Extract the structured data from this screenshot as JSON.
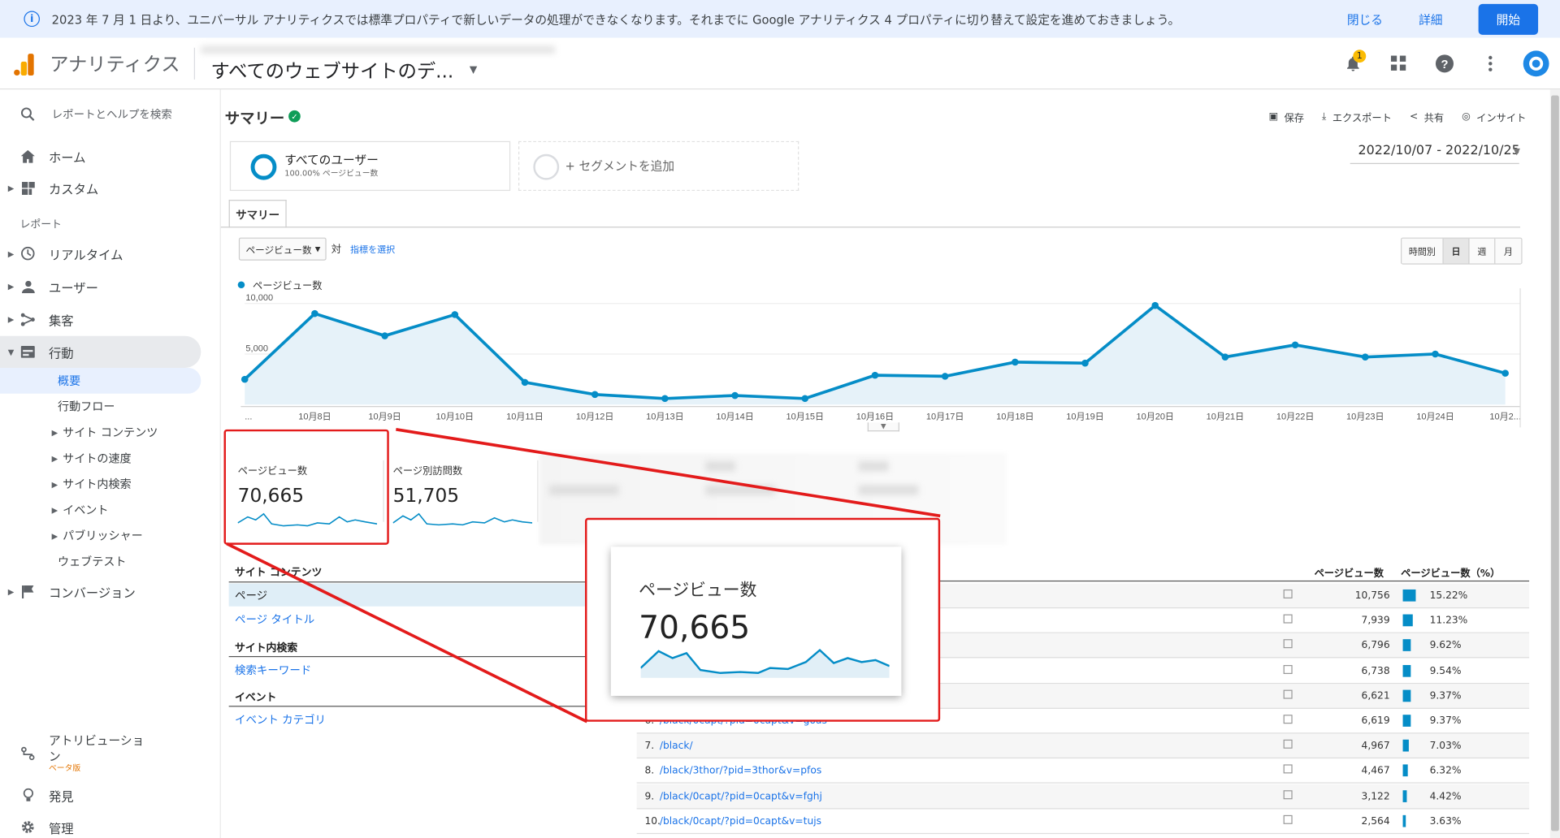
{
  "banner": {
    "message": "2023 年 7 月 1 日より、ユニバーサル アナリティクスでは標準プロパティで新しいデータの処理ができなくなります。それまでに Google アナリティクス 4 プロパティに切り替えて設定を進めておきましょう。",
    "close": "閉じる",
    "details": "詳細",
    "start": "開始"
  },
  "topbar": {
    "app_name": "アナリティクス",
    "property": "すべてのウェブサイトのデ...",
    "notification_count": "1"
  },
  "sidebar": {
    "search": "レポートとヘルプを検索",
    "home": "ホーム",
    "custom": "カスタム",
    "reports_header": "レポート",
    "realtime": "リアルタイム",
    "users": "ユーザー",
    "acquisition": "集客",
    "behavior": "行動",
    "overview": "概要",
    "behavior_flow": "行動フロー",
    "site_content": "サイト コンテンツ",
    "site_speed": "サイトの速度",
    "site_search": "サイト内検索",
    "events": "イベント",
    "publisher": "パブリッシャー",
    "experiments": "ウェブテスト",
    "conversions": "コンバージョン",
    "attribution_l1": "アトリビューショ",
    "attribution_l2": "ン",
    "beta": "ベータ版",
    "discover": "発見",
    "admin": "管理"
  },
  "main": {
    "title": "サマリー",
    "actions": {
      "save": "保存",
      "export": "エクスポート",
      "share": "共有",
      "insights": "インサイト"
    },
    "segment_name": "すべてのユーザー",
    "segment_sub": "100.00% ページビュー数",
    "add_segment": "+ セグメントを追加",
    "date_range": "2022/10/07 - 2022/10/25",
    "tab": "サマリー",
    "metric_select": "ページビュー数",
    "vs": "対",
    "pick_metric": "指標を選択",
    "granularity": [
      "時間別",
      "日",
      "週",
      "月"
    ],
    "legend": "ページビュー数"
  },
  "chart_data": {
    "type": "area",
    "series": [
      {
        "name": "ページビュー数",
        "values": [
          2500,
          9000,
          6800,
          8900,
          2200,
          1000,
          600,
          900,
          600,
          2900,
          2800,
          4200,
          4100,
          9800,
          4700,
          5900,
          4700,
          5000,
          3100
        ]
      }
    ],
    "x_labels": [
      "...",
      "10月8日",
      "10月9日",
      "10月10日",
      "10月11日",
      "10月12日",
      "10月13日",
      "10月14日",
      "10月15日",
      "10月16日",
      "10月17日",
      "10月18日",
      "10月19日",
      "10月20日",
      "10月21日",
      "10月22日",
      "10月23日",
      "10月24日",
      "10月2..."
    ],
    "y_ticks": [
      "10,000",
      "5,000"
    ],
    "ylim": [
      0,
      11500
    ]
  },
  "scorecards": [
    {
      "label": "ページビュー数",
      "value": "70,665"
    },
    {
      "label": "ページ別訪問数",
      "value": "51,705"
    }
  ],
  "left_table": {
    "site_content": "サイト コンテンツ",
    "page": "ページ",
    "page_title": "ページ タイトル",
    "site_search": "サイト内検索",
    "search_keyword": "検索キーワード",
    "events": "イベント",
    "event_category": "イベント カテゴリ"
  },
  "right_table": {
    "col_pv": "ページビュー数",
    "col_pct": "ページビュー数（%）",
    "rows": [
      {
        "num": "",
        "url": "",
        "pv": "10,756",
        "pct": "15.22%",
        "share": 0.1522
      },
      {
        "num": "",
        "url": "",
        "pv": "7,939",
        "pct": "11.23%",
        "share": 0.1123
      },
      {
        "num": "",
        "url": "",
        "pv": "6,796",
        "pct": "9.62%",
        "share": 0.0962
      },
      {
        "num": "",
        "url": "",
        "pv": "6,738",
        "pct": "9.54%",
        "share": 0.0954
      },
      {
        "num": "",
        "url": "",
        "pv": "6,621",
        "pct": "9.37%",
        "share": 0.0937
      },
      {
        "num": "6.",
        "url": "/black/0capt/?pid=0capt&v=goas",
        "pv": "6,619",
        "pct": "9.37%",
        "share": 0.0937
      },
      {
        "num": "7.",
        "url": "/black/",
        "pv": "4,967",
        "pct": "7.03%",
        "share": 0.0703
      },
      {
        "num": "8.",
        "url": "/black/3thor/?pid=3thor&v=pfos",
        "pv": "4,467",
        "pct": "6.32%",
        "share": 0.0632
      },
      {
        "num": "9.",
        "url": "/black/0capt/?pid=0capt&v=fghj",
        "pv": "3,122",
        "pct": "4.42%",
        "share": 0.0442
      },
      {
        "num": "10.",
        "url": "/black/0capt/?pid=0capt&v=tujs",
        "pv": "2,564",
        "pct": "3.63%",
        "share": 0.0363
      }
    ]
  },
  "zoom": {
    "label": "ページビュー数",
    "value": "70,665"
  },
  "colors": {
    "accent": "#058dc7",
    "annotation": "#e31b1b",
    "brand_blue": "#1a73e8"
  }
}
